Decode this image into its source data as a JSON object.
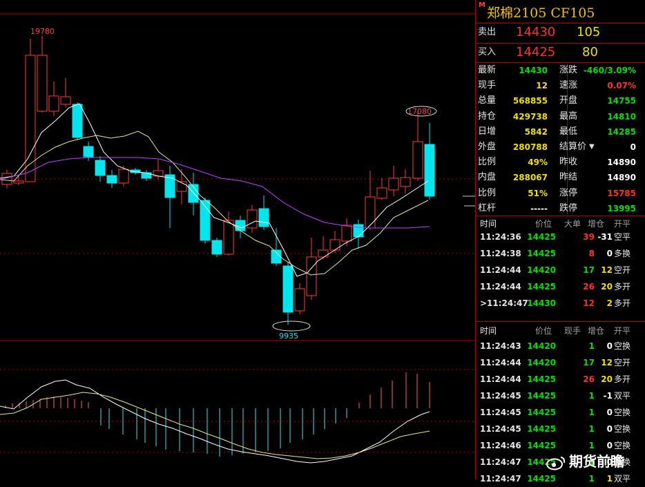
{
  "chart": {
    "high_label": "19780",
    "low_label": "9935",
    "recent_high_label": "17080",
    "colors": {
      "up": "#ff3a3a",
      "down": "#00e5ee",
      "ma_short": "#ffffff",
      "ma_mid": "#e8e890",
      "ma_long": "#c040ff",
      "grid": "#b00000"
    }
  },
  "header": {
    "marker": "M",
    "title": "郑棉2105  CF105"
  },
  "bid_ask": {
    "sell_label": "卖出",
    "sell_price": "14430",
    "sell_qty": "105",
    "buy_label": "买入",
    "buy_price": "14425",
    "buy_qty": "80"
  },
  "stats_left": [
    {
      "label": "最新",
      "value": "14430"
    },
    {
      "label": "现手",
      "value": "12"
    },
    {
      "label": "总量",
      "value": "568855"
    },
    {
      "label": "持仓",
      "value": "429738"
    },
    {
      "label": "日增",
      "value": "5842"
    },
    {
      "label": "外盘",
      "value": "280788"
    },
    {
      "label": "比例",
      "value": "49%"
    },
    {
      "label": "内盘",
      "value": "288067"
    },
    {
      "label": "比例",
      "value": "51%"
    },
    {
      "label": "杠杆",
      "value": "-----"
    }
  ],
  "stats_right": [
    {
      "label": "涨跌",
      "value": "-460/3.09%"
    },
    {
      "label": "速涨",
      "value": "0.07%"
    },
    {
      "label": "开盘",
      "value": "14755"
    },
    {
      "label": "最高",
      "value": "14810"
    },
    {
      "label": "最低",
      "value": "14285"
    },
    {
      "label": "结算价",
      "value": "0"
    },
    {
      "label": "昨收",
      "value": "14890"
    },
    {
      "label": "昨结",
      "value": "14890"
    },
    {
      "label": "涨停",
      "value": "15785"
    },
    {
      "label": "跌停",
      "value": "13995"
    }
  ],
  "big_orders": {
    "headers": [
      "时间",
      "价位",
      "大单",
      "增仓",
      "开平"
    ],
    "rows": [
      {
        "time": "11:24:36",
        "price": "14425",
        "vol": "39",
        "chg": "-31",
        "type": "空平"
      },
      {
        "time": "11:24:38",
        "price": "14425",
        "vol": "8",
        "chg": "0",
        "type": "多换"
      },
      {
        "time": "11:24:44",
        "price": "14420",
        "vol": "17",
        "chg": "12",
        "type": "空开"
      },
      {
        "time": "11:24:44",
        "price": "14425",
        "vol": "26",
        "chg": "20",
        "type": "多开"
      },
      {
        "time": ">11:24:47",
        "price": "14430",
        "vol": "12",
        "chg": "2",
        "type": "多开"
      }
    ]
  },
  "ticks": {
    "headers": [
      "时间",
      "价位",
      "现手",
      "增仓",
      "开平"
    ],
    "rows": [
      {
        "time": "11:24:43",
        "price": "14420",
        "vol": "1",
        "chg": "0",
        "type": "空换"
      },
      {
        "time": "11:24:44",
        "price": "14420",
        "vol": "17",
        "chg": "12",
        "type": "空开"
      },
      {
        "time": "11:24:44",
        "price": "14425",
        "vol": "26",
        "chg": "20",
        "type": "多开"
      },
      {
        "time": "11:24:45",
        "price": "14425",
        "vol": "1",
        "chg": "-1",
        "type": "双平"
      },
      {
        "time": "11:24:45",
        "price": "14425",
        "vol": "1",
        "chg": "0",
        "type": "空换"
      },
      {
        "time": "11:24:45",
        "price": "14425",
        "vol": "1",
        "chg": "0",
        "type": "空换"
      },
      {
        "time": "11:24:46",
        "price": "14425",
        "vol": "1",
        "chg": "0",
        "type": "空换"
      },
      {
        "time": "11:24:47",
        "price": "14425",
        "vol": "1",
        "chg": "0",
        "type": "多换"
      },
      {
        "time": "11:24:47",
        "price": "14425",
        "vol": "1",
        "chg": "1",
        "type": "双平"
      }
    ]
  },
  "watermark": {
    "text": "期货前瞻"
  }
}
